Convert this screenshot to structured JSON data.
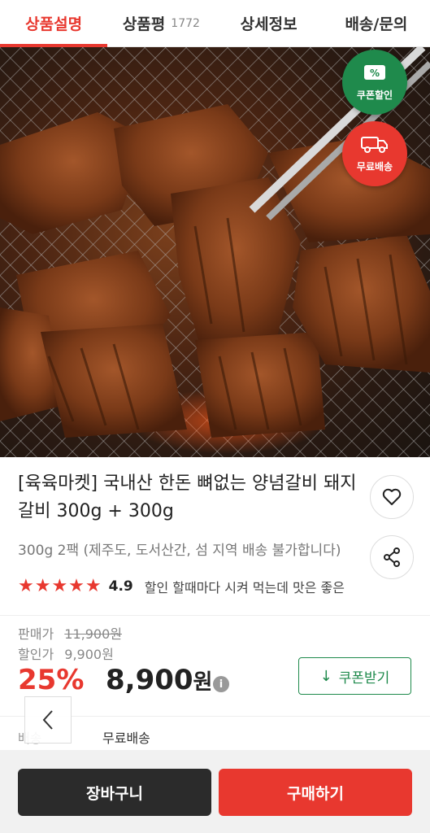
{
  "tabs": [
    {
      "label": "상품설명"
    },
    {
      "label": "상품평",
      "count": "1772"
    },
    {
      "label": "상세정보"
    },
    {
      "label": "배송/문의"
    }
  ],
  "badges": {
    "coupon": "쿠폰할인",
    "shipping": "무료배송"
  },
  "product": {
    "title": "[육육마켓] 국내산 한돈 뼈없는 양념갈비 돼지갈비 300g + 300g",
    "subtitle": "300g 2팩 (제주도, 도서산간, 섬 지역 배송 불가합니다)",
    "stars": "★★★★★",
    "rating": "4.9",
    "review_snippet": "할인 할때마다 시켜 먹는데 맛은 좋은"
  },
  "price": {
    "sale_label": "판매가",
    "sale_value": "11,900원",
    "discounted_label": "할인가",
    "discounted_value": "9,900원",
    "discount_pct": "25%",
    "final_amount": "8,900",
    "final_unit": "원",
    "info_icon": "i",
    "coupon_button": "쿠폰받기"
  },
  "shipping": {
    "label": "배송",
    "value": "무료배송"
  },
  "actions": {
    "cart": "장바구니",
    "buy": "구매하기"
  },
  "colors": {
    "accent_red": "#e8382f",
    "accent_green": "#1f8a4c",
    "dark": "#2b2b2b"
  }
}
